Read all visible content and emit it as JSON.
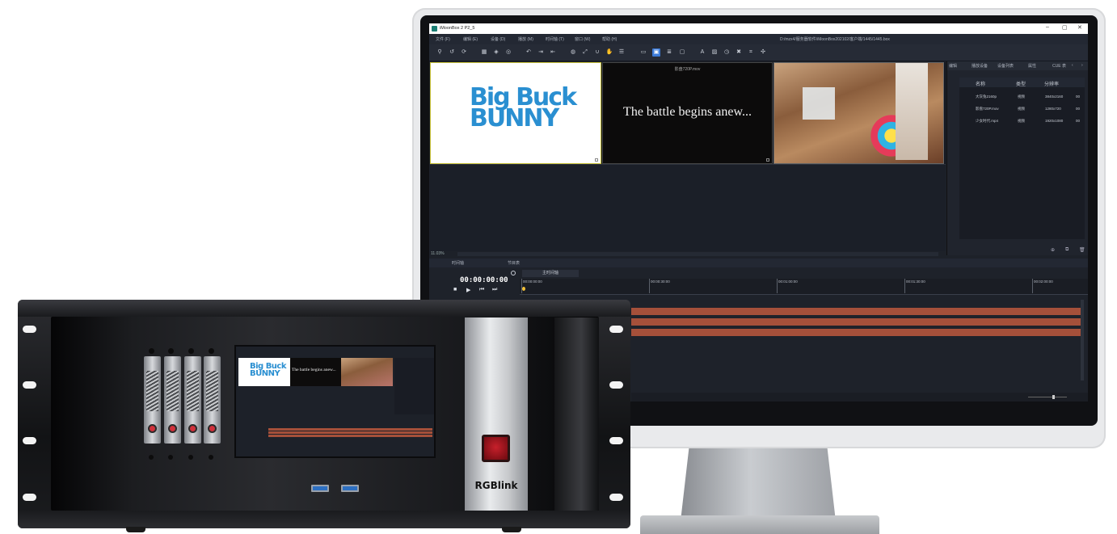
{
  "window": {
    "title": "iMoonBox 2 P2_5",
    "file_path": "D:/mzx4/服务器软件/iMoonBox202102/客户端/1445/1445.box",
    "controls": [
      "–",
      "▢",
      "✕"
    ]
  },
  "menu": [
    "文件 (F)",
    "编辑 (E)",
    "设备 (D)",
    "播放 (M)",
    "时间轴 (T)",
    "窗口 (W)",
    "帮助 (H)"
  ],
  "toolbar_icons": [
    "link-icon",
    "rotate-left-icon",
    "refresh-icon",
    "grid-icon",
    "layers-icon",
    "target-icon",
    "undo-icon",
    "import-icon",
    "export-icon",
    "globe-icon",
    "resize-icon",
    "magnet-icon",
    "palm-icon",
    "list-icon",
    "monitor-icon",
    "select-icon",
    "align-icon",
    "screen-icon",
    "text-icon",
    "image-icon",
    "timer-icon",
    "cross-icon",
    "crop-icon",
    "more-icon"
  ],
  "preview": {
    "panel1_logo_line1": "Big Buck",
    "panel1_logo_line2": "BUNNY",
    "panel2_caption": "影盘720P.mov",
    "panel2_text": "The battle begins anew...",
    "zoom": "11.03%"
  },
  "right_panel": {
    "tabs": [
      "编辑",
      "播放设备",
      "设备列表",
      "属性",
      "CUE 表"
    ],
    "columns": [
      "名称",
      "类型",
      "分辨率"
    ],
    "rows": [
      {
        "name": "大灰兔2160p",
        "type": "视频",
        "resolution": "3840x2160",
        "extra": "00"
      },
      {
        "name": "影盘720P.mov",
        "type": "视频",
        "resolution": "1280x720",
        "extra": "00"
      },
      {
        "name": "少女时代.mp4",
        "type": "视频",
        "resolution": "1920x1080",
        "extra": "00"
      }
    ]
  },
  "timeline": {
    "tabs": [
      "时间轴",
      "节目表"
    ],
    "main_tab": "主时间轴",
    "timecode": "00:00:00:00",
    "ruler_labels": [
      "00:00:00:00",
      "00:00:30:00",
      "00:01:00:00",
      "00:01:30:00",
      "00:02:00:00"
    ]
  },
  "device": {
    "brand": "RGBlink",
    "mini_screen_text": "The battle begins anew...",
    "mini_logo_line1": "Big Buck",
    "mini_logo_line2": "BUNNY"
  }
}
